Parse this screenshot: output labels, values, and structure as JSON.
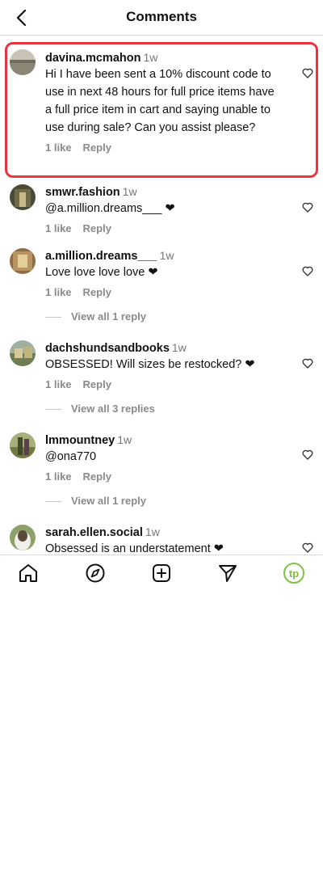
{
  "header": {
    "title": "Comments"
  },
  "comments": [
    {
      "username": "davina.mcmahon",
      "time": "1w",
      "text": "Hi I have been sent a 10% discount code to use in next 48 hours for full price items have a full price item in cart and saying unable to use during sale? Can you assist please?",
      "likes": "1 like",
      "reply": "Reply"
    },
    {
      "username": "smwr.fashion",
      "time": "1w",
      "text": "@a.million.dreams___ ❤",
      "likes": "1 like",
      "reply": "Reply"
    },
    {
      "username": "a.million.dreams___",
      "time": "1w",
      "text": "Love love love love ❤",
      "likes": "1 like",
      "reply": "Reply",
      "view_replies": "View all 1 reply"
    },
    {
      "username": "dachshundsandbooks",
      "time": "1w",
      "text": "OBSESSED! Will sizes be restocked? ❤",
      "likes": "1 like",
      "reply": "Reply",
      "view_replies": "View all 3 replies"
    },
    {
      "username": "lmmountney",
      "time": "1w",
      "text": "@ona770",
      "likes": "1 like",
      "reply": "Reply",
      "view_replies": "View all 1 reply"
    },
    {
      "username": "sarah.ellen.social",
      "time": "1w",
      "text": "Obsessed is an understatement ❤"
    }
  ],
  "icons": {
    "back": "chevron-left-icon",
    "heart": "heart-outline-icon",
    "home": "home-icon",
    "explore": "compass-icon",
    "create": "plus-square-icon",
    "direct": "paper-plane-icon",
    "profile": "profile-avatar-tp"
  },
  "profile": {
    "initials": "tp"
  },
  "colors": {
    "highlight": "#e8353f",
    "profile_ring": "#7dc242",
    "muted": "#8a8a8a"
  }
}
